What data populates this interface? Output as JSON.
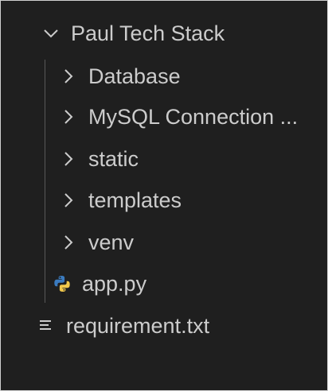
{
  "explorer": {
    "root": {
      "label": "Paul Tech Stack",
      "icon": "chevron-down-icon",
      "expanded": true
    },
    "items": [
      {
        "label": "Database",
        "icon": "chevron-right-icon",
        "kind": "folder"
      },
      {
        "label": "MySQL Connection ...",
        "icon": "chevron-right-icon",
        "kind": "folder"
      },
      {
        "label": "static",
        "icon": "chevron-right-icon",
        "kind": "folder"
      },
      {
        "label": "templates",
        "icon": "chevron-right-icon",
        "kind": "folder"
      },
      {
        "label": "venv",
        "icon": "chevron-right-icon",
        "kind": "folder"
      },
      {
        "label": "app.py",
        "icon": "python-file-icon",
        "kind": "file"
      }
    ],
    "outside_file": {
      "label": "requirement.txt",
      "icon": "text-file-icon",
      "kind": "file"
    }
  },
  "colors": {
    "background": "#1f1f1f",
    "text": "#cccccc",
    "python_blue": "#3b7bbf",
    "python_yellow": "#f2c94c"
  }
}
